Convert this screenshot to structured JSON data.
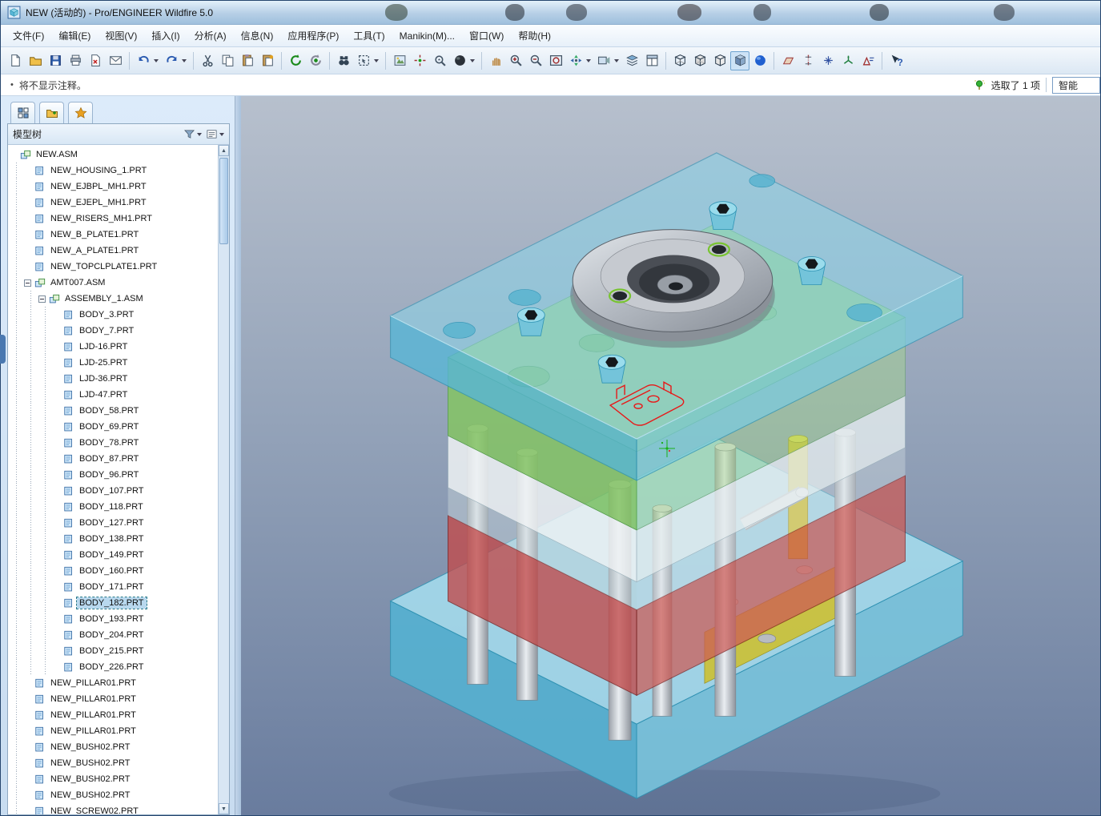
{
  "window": {
    "title": "NEW (活动的) - Pro/ENGINEER Wildfire 5.0"
  },
  "menubar": {
    "items": [
      {
        "id": "file",
        "label": "文件(F)"
      },
      {
        "id": "edit",
        "label": "编辑(E)"
      },
      {
        "id": "view",
        "label": "视图(V)"
      },
      {
        "id": "insert",
        "label": "插入(I)"
      },
      {
        "id": "analysis",
        "label": "分析(A)"
      },
      {
        "id": "info",
        "label": "信息(N)"
      },
      {
        "id": "applications",
        "label": "应用程序(P)"
      },
      {
        "id": "tools",
        "label": "工具(T)"
      },
      {
        "id": "manikin",
        "label": "Manikin(M)..."
      },
      {
        "id": "window",
        "label": "窗口(W)"
      },
      {
        "id": "help",
        "label": "帮助(H)"
      }
    ]
  },
  "toolbar": {
    "items": [
      {
        "t": "b",
        "name": "new-file",
        "icon": "page"
      },
      {
        "t": "b",
        "name": "open-file",
        "icon": "folder"
      },
      {
        "t": "b",
        "name": "save",
        "icon": "floppy"
      },
      {
        "t": "b",
        "name": "print",
        "icon": "printer"
      },
      {
        "t": "b",
        "name": "delete-old-versions",
        "icon": "pagex"
      },
      {
        "t": "b",
        "name": "send-mail",
        "icon": "mail"
      },
      {
        "t": "s"
      },
      {
        "t": "b",
        "name": "undo",
        "icon": "undo",
        "caret": true
      },
      {
        "t": "b",
        "name": "redo",
        "icon": "redo",
        "caret": true
      },
      {
        "t": "s"
      },
      {
        "t": "b",
        "name": "cut",
        "icon": "cut"
      },
      {
        "t": "b",
        "name": "copy",
        "icon": "copy"
      },
      {
        "t": "b",
        "name": "paste",
        "icon": "paste"
      },
      {
        "t": "b",
        "name": "paste-special",
        "icon": "pastesp"
      },
      {
        "t": "s"
      },
      {
        "t": "b",
        "name": "regenerate",
        "icon": "regen"
      },
      {
        "t": "b",
        "name": "auto-regenerate",
        "icon": "regen2"
      },
      {
        "t": "s"
      },
      {
        "t": "b",
        "name": "find",
        "icon": "find"
      },
      {
        "t": "b",
        "name": "select-box",
        "icon": "selbox",
        "caret": true
      },
      {
        "t": "s"
      },
      {
        "t": "b",
        "name": "repaint",
        "icon": "repaint"
      },
      {
        "t": "b",
        "name": "spin-center",
        "icon": "spin"
      },
      {
        "t": "b",
        "name": "orient-mode",
        "icon": "orientmode"
      },
      {
        "t": "b",
        "name": "display-style",
        "icon": "sphere",
        "caret": true
      },
      {
        "t": "s"
      },
      {
        "t": "b",
        "name": "drag-mode",
        "icon": "hand"
      },
      {
        "t": "b",
        "name": "zoom-in",
        "icon": "zoomin"
      },
      {
        "t": "b",
        "name": "zoom-out",
        "icon": "zoomout"
      },
      {
        "t": "b",
        "name": "refit",
        "icon": "refit"
      },
      {
        "t": "b",
        "name": "reorient",
        "icon": "orient",
        "caret": true
      },
      {
        "t": "b",
        "name": "saved-views",
        "icon": "views",
        "caret": true
      },
      {
        "t": "b",
        "name": "layers",
        "icon": "layers"
      },
      {
        "t": "b",
        "name": "view-manager",
        "icon": "viewmgr"
      },
      {
        "t": "s"
      },
      {
        "t": "b",
        "name": "wireframe",
        "icon": "cwire"
      },
      {
        "t": "b",
        "name": "hidden-line",
        "icon": "chidden"
      },
      {
        "t": "b",
        "name": "no-hidden",
        "icon": "cnohid"
      },
      {
        "t": "b",
        "name": "shaded",
        "icon": "cshaded",
        "pressed": true
      },
      {
        "t": "b",
        "name": "enhanced-realism",
        "icon": "realism"
      },
      {
        "t": "s"
      },
      {
        "t": "b",
        "name": "datum-planes",
        "icon": "dplane"
      },
      {
        "t": "b",
        "name": "datum-axes",
        "icon": "daxis"
      },
      {
        "t": "b",
        "name": "datum-points",
        "icon": "dpoint"
      },
      {
        "t": "b",
        "name": "datum-csys",
        "icon": "dcsys"
      },
      {
        "t": "b",
        "name": "annotations",
        "icon": "dannot"
      },
      {
        "t": "s"
      },
      {
        "t": "b",
        "name": "context-help",
        "icon": "help"
      }
    ]
  },
  "notification": {
    "bullet": "•",
    "message": "将不显示注释。"
  },
  "status": {
    "selection": "选取了 1 项",
    "filter": "智能"
  },
  "navigator": {
    "tabs": [
      {
        "name": "model-tree-tab",
        "icon": "tabtree"
      },
      {
        "name": "folder-browser-tab",
        "icon": "tabfolder"
      },
      {
        "name": "favorites-tab",
        "icon": "tabstar"
      }
    ],
    "tree_header": {
      "title": "模型树"
    },
    "tree": {
      "items": [
        {
          "label": "NEW.ASM",
          "depth": 0,
          "icon": "asm"
        },
        {
          "label": "NEW_HOUSING_1.PRT",
          "depth": 1,
          "icon": "prt"
        },
        {
          "label": "NEW_EJBPL_MH1.PRT",
          "depth": 1,
          "icon": "prt"
        },
        {
          "label": "NEW_EJEPL_MH1.PRT",
          "depth": 1,
          "icon": "prt"
        },
        {
          "label": "NEW_RISERS_MH1.PRT",
          "depth": 1,
          "icon": "prt"
        },
        {
          "label": "NEW_B_PLATE1.PRT",
          "depth": 1,
          "icon": "prt"
        },
        {
          "label": "NEW_A_PLATE1.PRT",
          "depth": 1,
          "icon": "prt"
        },
        {
          "label": "NEW_TOPCLPLATE1.PRT",
          "depth": 1,
          "icon": "prt"
        },
        {
          "label": "AMT007.ASM",
          "depth": 1,
          "icon": "asm",
          "exp": true
        },
        {
          "label": "ASSEMBLY_1.ASM",
          "depth": 2,
          "icon": "asm",
          "exp": true
        },
        {
          "label": "BODY_3.PRT",
          "depth": 3,
          "icon": "prt"
        },
        {
          "label": "BODY_7.PRT",
          "depth": 3,
          "icon": "prt"
        },
        {
          "label": "LJD-16.PRT",
          "depth": 3,
          "icon": "prt"
        },
        {
          "label": "LJD-25.PRT",
          "depth": 3,
          "icon": "prt"
        },
        {
          "label": "LJD-36.PRT",
          "depth": 3,
          "icon": "prt"
        },
        {
          "label": "LJD-47.PRT",
          "depth": 3,
          "icon": "prt"
        },
        {
          "label": "BODY_58.PRT",
          "depth": 3,
          "icon": "prt"
        },
        {
          "label": "BODY_69.PRT",
          "depth": 3,
          "icon": "prt"
        },
        {
          "label": "BODY_78.PRT",
          "depth": 3,
          "icon": "prt"
        },
        {
          "label": "BODY_87.PRT",
          "depth": 3,
          "icon": "prt"
        },
        {
          "label": "BODY_96.PRT",
          "depth": 3,
          "icon": "prt"
        },
        {
          "label": "BODY_107.PRT",
          "depth": 3,
          "icon": "prt"
        },
        {
          "label": "BODY_118.PRT",
          "depth": 3,
          "icon": "prt"
        },
        {
          "label": "BODY_127.PRT",
          "depth": 3,
          "icon": "prt"
        },
        {
          "label": "BODY_138.PRT",
          "depth": 3,
          "icon": "prt"
        },
        {
          "label": "BODY_149.PRT",
          "depth": 3,
          "icon": "prt"
        },
        {
          "label": "BODY_160.PRT",
          "depth": 3,
          "icon": "prt"
        },
        {
          "label": "BODY_171.PRT",
          "depth": 3,
          "icon": "prt"
        },
        {
          "label": "BODY_182.PRT",
          "depth": 3,
          "icon": "prt",
          "selected": true
        },
        {
          "label": "BODY_193.PRT",
          "depth": 3,
          "icon": "prt"
        },
        {
          "label": "BODY_204.PRT",
          "depth": 3,
          "icon": "prt"
        },
        {
          "label": "BODY_215.PRT",
          "depth": 3,
          "icon": "prt"
        },
        {
          "label": "BODY_226.PRT",
          "depth": 3,
          "icon": "prt"
        },
        {
          "label": "NEW_PILLAR01.PRT",
          "depth": 1,
          "icon": "prt"
        },
        {
          "label": "NEW_PILLAR01.PRT",
          "depth": 1,
          "icon": "prt"
        },
        {
          "label": "NEW_PILLAR01.PRT",
          "depth": 1,
          "icon": "prt"
        },
        {
          "label": "NEW_PILLAR01.PRT",
          "depth": 1,
          "icon": "prt"
        },
        {
          "label": "NEW_BUSH02.PRT",
          "depth": 1,
          "icon": "prt"
        },
        {
          "label": "NEW_BUSH02.PRT",
          "depth": 1,
          "icon": "prt"
        },
        {
          "label": "NEW_BUSH02.PRT",
          "depth": 1,
          "icon": "prt"
        },
        {
          "label": "NEW_BUSH02.PRT",
          "depth": 1,
          "icon": "prt"
        },
        {
          "label": "NEW_SCREW02.PRT",
          "depth": 1,
          "icon": "prt"
        }
      ]
    }
  },
  "viewport": {
    "model_colors": {
      "clamp_plates": "#8ed2e6",
      "cavity_plate": "#96d46e",
      "riser_plates": "#c24a4a",
      "support_plate": "#eef2f4",
      "guide_pillars": "#c8ccd0",
      "ejector_screws": "#d2c028",
      "locating_ring": "#b8bcc2",
      "selection_highlight": "#e81818"
    }
  }
}
